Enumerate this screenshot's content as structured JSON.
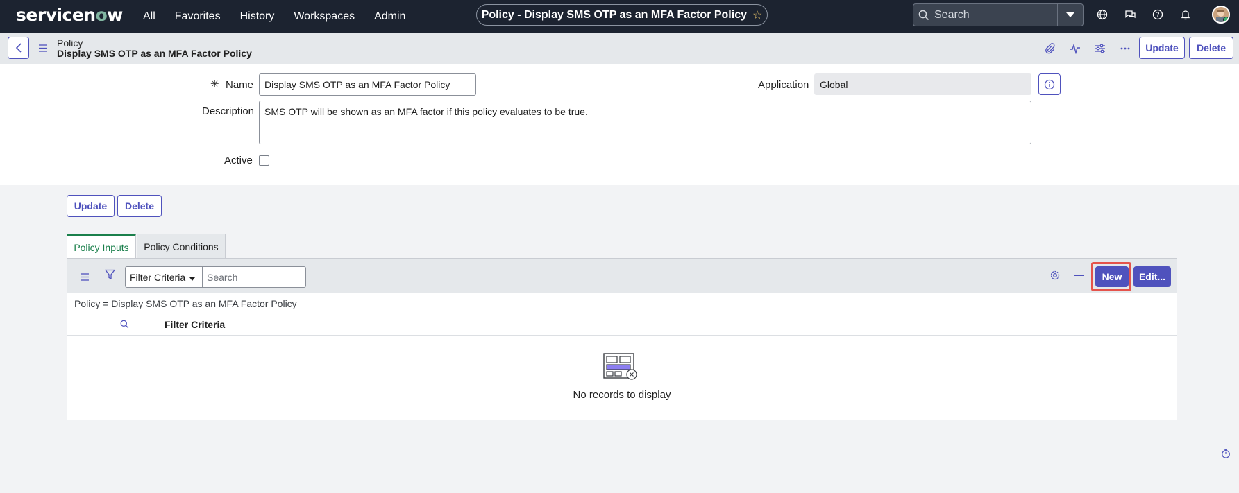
{
  "topnav": {
    "logo": "servicenow",
    "menu": [
      "All",
      "Favorites",
      "History",
      "Workspaces",
      "Admin"
    ],
    "context_title": "Policy - Display SMS OTP as an MFA Factor Policy",
    "search_placeholder": "Search",
    "icons": [
      "globe-icon",
      "chat-icon",
      "help-icon",
      "bell-icon"
    ]
  },
  "header": {
    "table_label": "Policy",
    "record_title": "Display SMS OTP as an MFA Factor Policy",
    "update_label": "Update",
    "delete_label": "Delete"
  },
  "form": {
    "name_label": "Name",
    "name_value": "Display SMS OTP as an MFA Factor Policy",
    "application_label": "Application",
    "application_value": "Global",
    "description_label": "Description",
    "description_value": "SMS OTP will be shown as an MFA factor if this policy evaluates to be true.",
    "active_label": "Active",
    "active_checked": false,
    "update_label": "Update",
    "delete_label": "Delete"
  },
  "tabs": [
    {
      "label": "Policy Inputs",
      "active": true
    },
    {
      "label": "Policy Conditions",
      "active": false
    }
  ],
  "related_list": {
    "filter_select": "Filter Criteria",
    "search_placeholder": "Search",
    "new_label": "New",
    "edit_label": "Edit...",
    "breadcrumb": "Policy = Display SMS OTP as an MFA Factor Policy",
    "column": "Filter Criteria",
    "empty_message": "No records to display"
  },
  "colors": {
    "nav_bg": "#1c2330",
    "accent": "#4f52bd",
    "tab_active": "#1a7f4b",
    "highlight": "#e5534b"
  }
}
